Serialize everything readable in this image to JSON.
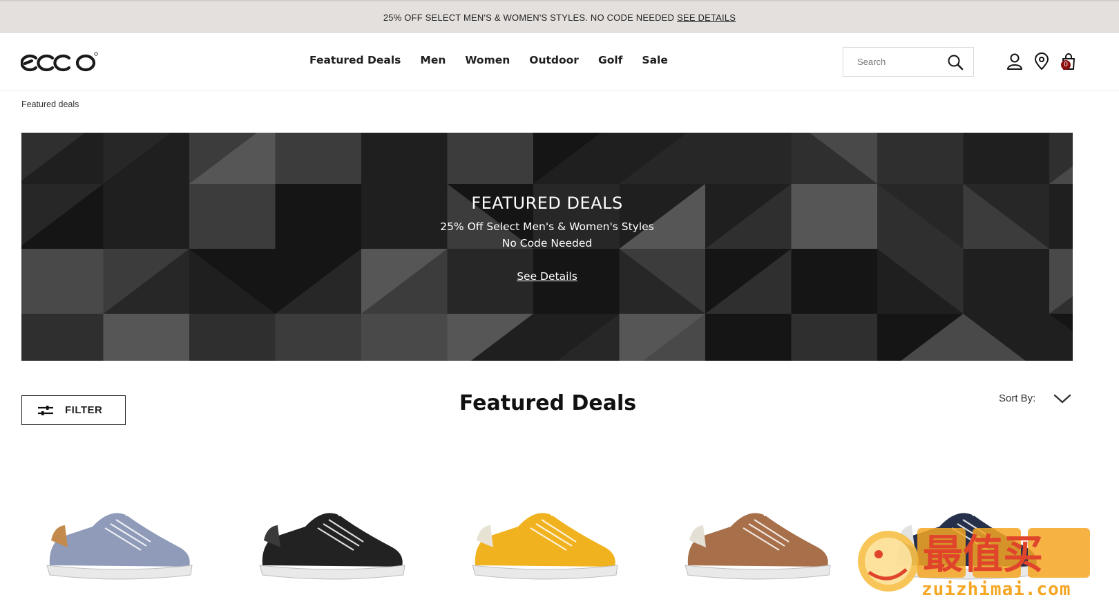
{
  "promo": {
    "text": "25% OFF SELECT MEN'S & WOMEN'S STYLES. NO CODE NEEDED",
    "link": "SEE DETAILS"
  },
  "header": {
    "logo": "ecco",
    "nav": [
      "Featured Deals",
      "Men",
      "Women",
      "Outdoor",
      "Golf",
      "Sale"
    ],
    "search_placeholder": "Search",
    "icons": [
      "account-icon",
      "location-pin-icon",
      "shopping-bag-icon"
    ],
    "cart_count": "0"
  },
  "breadcrumb": "Featured deals",
  "hero": {
    "title": "FEATURED DEALS",
    "subtitle": "25% Off Select Men's & Women's Styles",
    "subtitle2": "No Code Needed",
    "link": "See Details"
  },
  "listing": {
    "filter_label": "FILTER",
    "title": "Featured Deals",
    "sort_label": "Sort By:"
  },
  "products": [
    {
      "color": "#8f9bb9",
      "accent": "#c38a4d"
    },
    {
      "color": "#222222",
      "accent": "#3a3a3a"
    },
    {
      "color": "#f1b21f",
      "accent": "#e8e2d4"
    },
    {
      "color": "#a8704a",
      "accent": "#e5e0d6"
    },
    {
      "color": "#26304a",
      "accent": "#e2e2e2"
    }
  ],
  "watermark": {
    "text": "zuizhimai.com",
    "label": "最值买"
  }
}
